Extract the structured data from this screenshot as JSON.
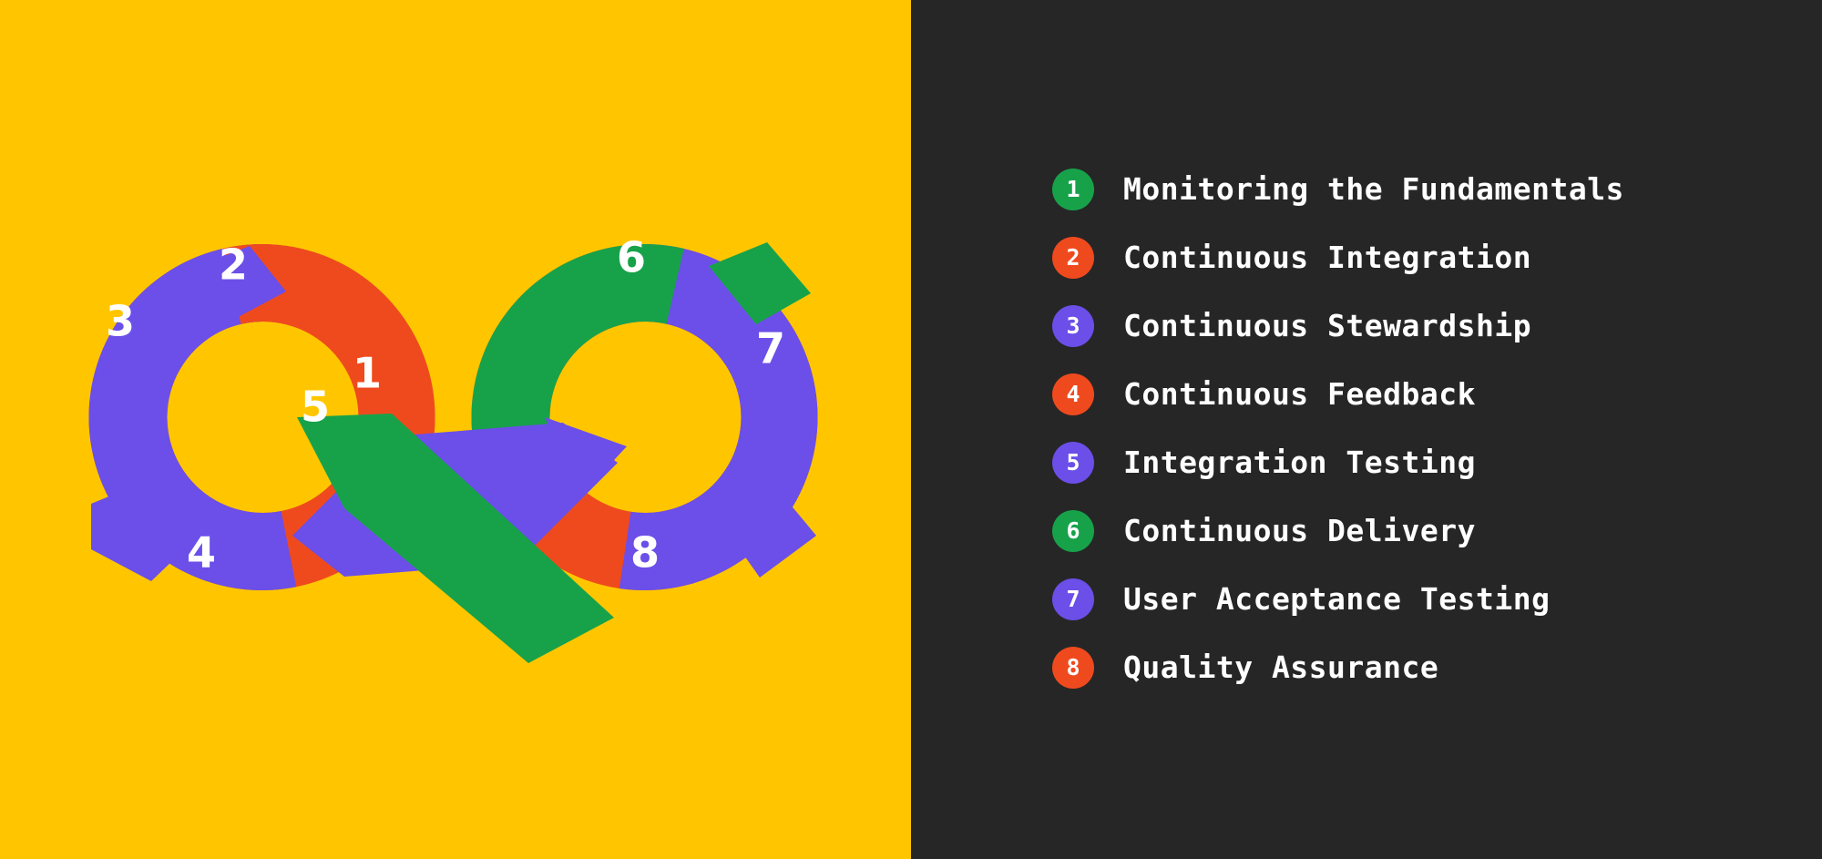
{
  "colors": {
    "canvas_left": "#FFC600",
    "canvas_right": "#262626",
    "green": "#17A24A",
    "orange": "#EF4A1E",
    "purple": "#6B4FE8",
    "number_text": "#FFFFFF",
    "label_text": "#FFFFFF"
  },
  "diagram": {
    "name": "devops-infinity-loop",
    "shape": "infinity",
    "segments": [
      {
        "number": "1",
        "color": "#17A24A",
        "position": "center-crossing-green-band"
      },
      {
        "number": "2",
        "color": "#EF4A1E",
        "position": "left-loop-top-right"
      },
      {
        "number": "3",
        "color": "#6B4FE8",
        "position": "left-loop-left"
      },
      {
        "number": "4",
        "color": "#EF4A1E",
        "position": "left-loop-bottom"
      },
      {
        "number": "5",
        "color": "#6B4FE8",
        "position": "center-crossing-purple-band"
      },
      {
        "number": "6",
        "color": "#17A24A",
        "position": "right-loop-top"
      },
      {
        "number": "7",
        "color": "#6B4FE8",
        "position": "right-loop-right"
      },
      {
        "number": "8",
        "color": "#EF4A1E",
        "position": "right-loop-bottom"
      }
    ]
  },
  "legend": {
    "items": [
      {
        "number": "1",
        "label": "Monitoring the Fundamentals",
        "color": "#17A24A"
      },
      {
        "number": "2",
        "label": "Continuous Integration",
        "color": "#EF4A1E"
      },
      {
        "number": "3",
        "label": "Continuous Stewardship",
        "color": "#6B4FE8"
      },
      {
        "number": "4",
        "label": "Continuous Feedback",
        "color": "#EF4A1E"
      },
      {
        "number": "5",
        "label": "Integration Testing",
        "color": "#6B4FE8"
      },
      {
        "number": "6",
        "label": "Continuous Delivery",
        "color": "#17A24A"
      },
      {
        "number": "7",
        "label": "User Acceptance Testing",
        "color": "#6B4FE8"
      },
      {
        "number": "8",
        "label": "Quality Assurance",
        "color": "#EF4A1E"
      }
    ]
  }
}
